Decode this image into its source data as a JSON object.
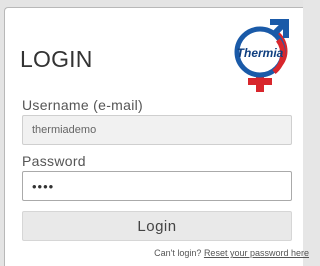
{
  "title": "LOGIN",
  "logo": {
    "text": "Thermia",
    "colors": {
      "blue": "#1a5aa8",
      "red": "#d8262c",
      "dark_blue": "#0f3f80"
    }
  },
  "username": {
    "label": "Username (e-mail)",
    "value": "thermiademo"
  },
  "password": {
    "label": "Password",
    "value": "••••"
  },
  "login_button": "Login",
  "help": {
    "prefix": "Can't login?",
    "link": "Reset your password here"
  }
}
